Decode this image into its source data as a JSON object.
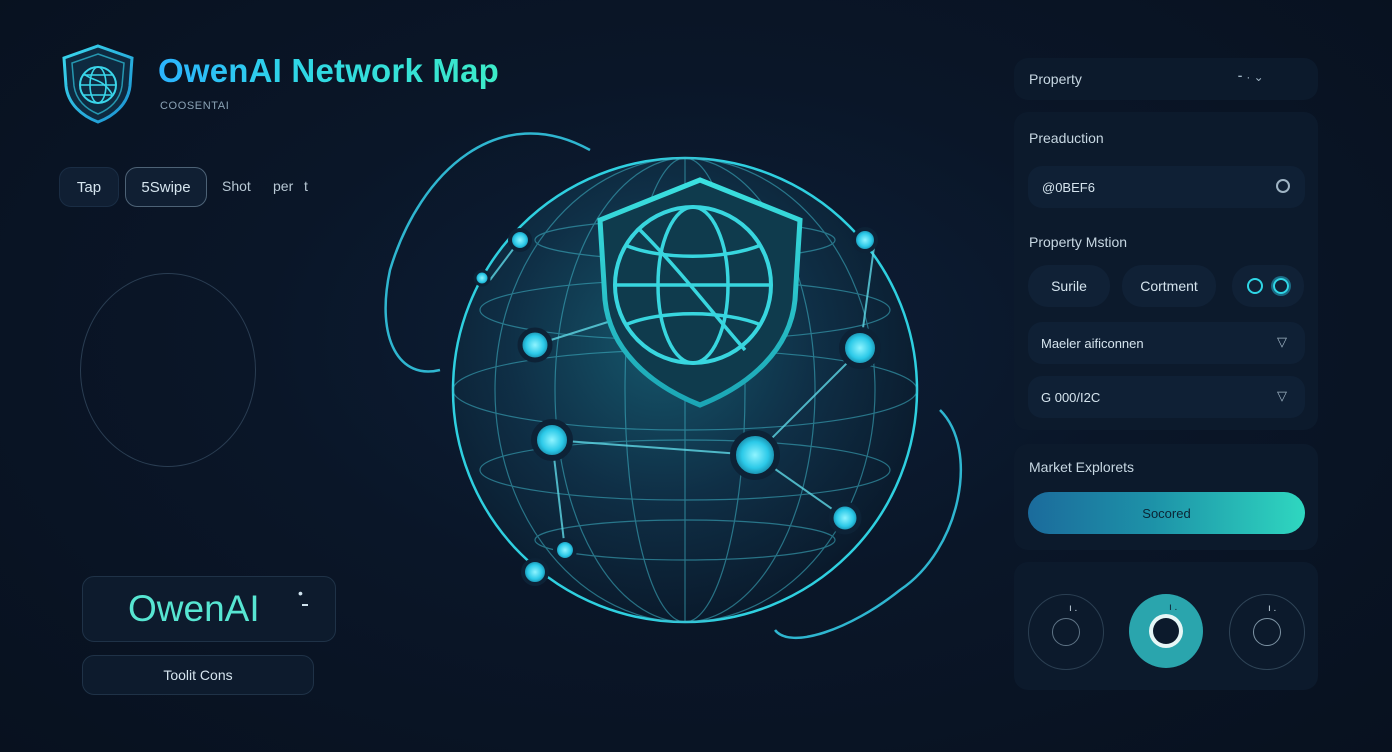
{
  "header": {
    "title": "OwenAI Network Map",
    "subtitle": "COOSENTAI"
  },
  "tabs": [
    {
      "label": "Tap"
    },
    {
      "label": "5Swipe"
    },
    {
      "label": "Shot"
    },
    {
      "label": "per"
    },
    {
      "label": "t"
    }
  ],
  "brand": {
    "name": "OwenAI",
    "toolbar_label": "Toolit Cons"
  },
  "panel": {
    "property_label": "Property",
    "production": {
      "label": "Preaduction",
      "value": "@0BEF6"
    },
    "property_mstion": {
      "label": "Property Mstion",
      "options": [
        "Surile",
        "Cortment"
      ]
    },
    "dropdowns": [
      {
        "value": "Maeler aificonnen"
      },
      {
        "value": "G 000/I2C"
      }
    ],
    "market": {
      "label": "Market Explorets",
      "button": "Socored"
    }
  },
  "colors": {
    "background": "#0a1628",
    "accent": "#2fd6e6",
    "accent_green": "#3cecc8",
    "panel": "#0c1a2c"
  },
  "icons": [
    "shield-globe-icon",
    "chevron-down-icon",
    "gear-icon",
    "toggle-icon",
    "dial-icon"
  ]
}
